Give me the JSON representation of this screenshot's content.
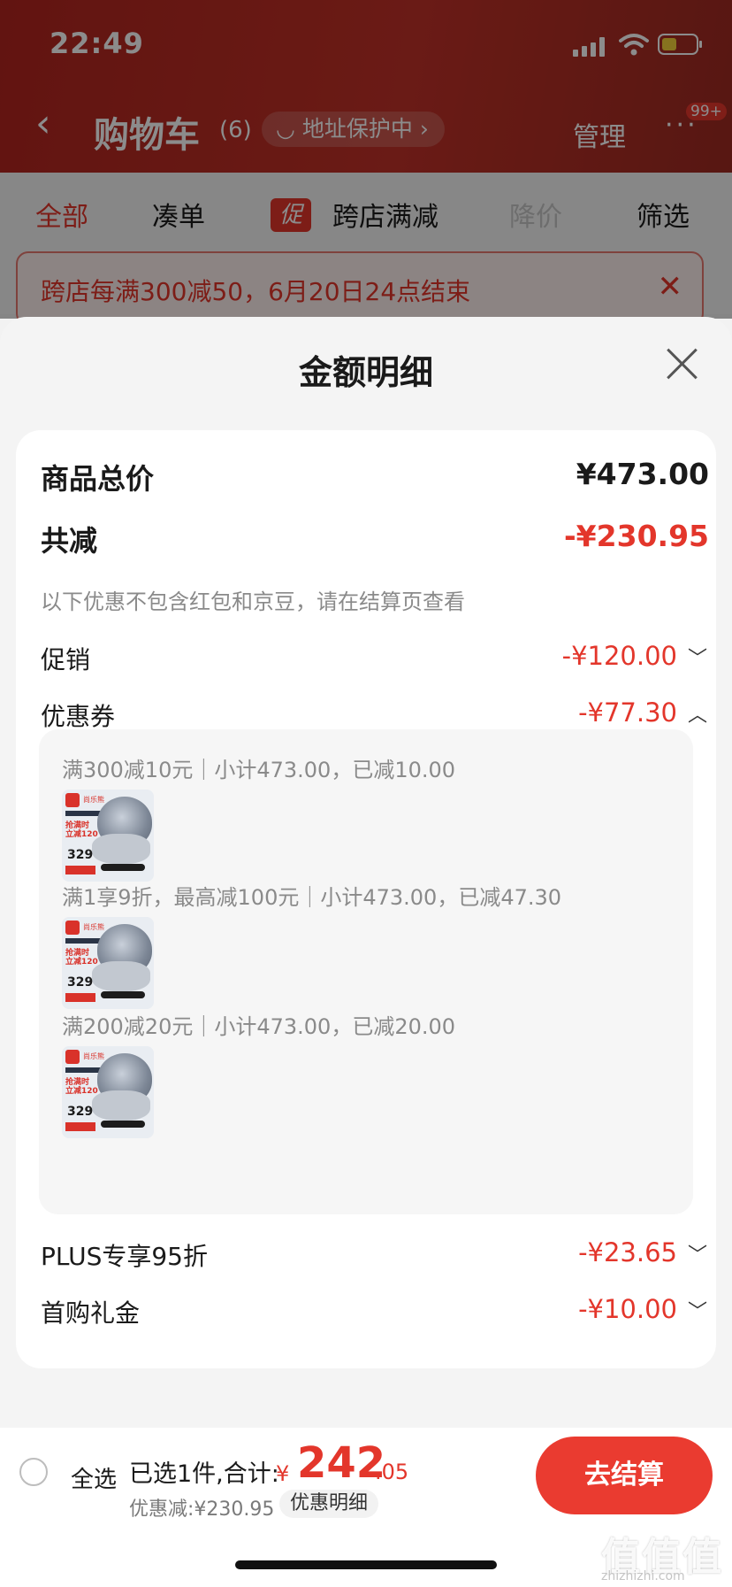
{
  "status": {
    "time": "22:49"
  },
  "background": {
    "title": "购物车",
    "count": "(6)",
    "address_pill": "地址保护中",
    "manage": "管理",
    "more_badge": "99+",
    "filters": {
      "all": "全部",
      "cou": "凑单",
      "promo_tag": "促",
      "cross": "跨店满减",
      "drop": "降价",
      "filter": "筛选"
    },
    "banner": "跨店每满300减50，6月20日24点结束"
  },
  "sheet": {
    "title": "金额明细",
    "total": {
      "label": "商品总价",
      "value": "¥473.00"
    },
    "reduced": {
      "label": "共减",
      "value": "-¥230.95"
    },
    "note": "以下优惠不包含红包和京豆，请在结算页查看",
    "promotion": {
      "label": "促销",
      "value": "-¥120.00"
    },
    "coupon": {
      "label": "优惠券",
      "value": "-¥77.30"
    },
    "coupon_lines": [
      "满300减10元｜小计473.00，已减10.00",
      "满1享9折，最高减100元｜小计473.00，已减47.30",
      "满200减20元｜小计473.00，已减20.00"
    ],
    "thumb": {
      "brand": "尚乐熊",
      "promo": "抢满时\n立减120",
      "price": "329"
    },
    "plus": {
      "label": "PLUS专享95折",
      "value": "-¥23.65"
    },
    "first": {
      "label": "首购礼金",
      "value": "-¥10.00"
    }
  },
  "bottom": {
    "select_all": "全选",
    "selected_prefix": "已选1件,合计:",
    "currency": "¥",
    "amount_int": "242",
    "amount_dec": ".05",
    "discount": "优惠减:¥230.95",
    "detail": "优惠明细",
    "checkout": "去结算"
  },
  "watermark": {
    "main": "值值值",
    "sub": "zhizhizhi.com"
  },
  "colors": {
    "accent": "#e3362b",
    "header": "#b3251f"
  }
}
